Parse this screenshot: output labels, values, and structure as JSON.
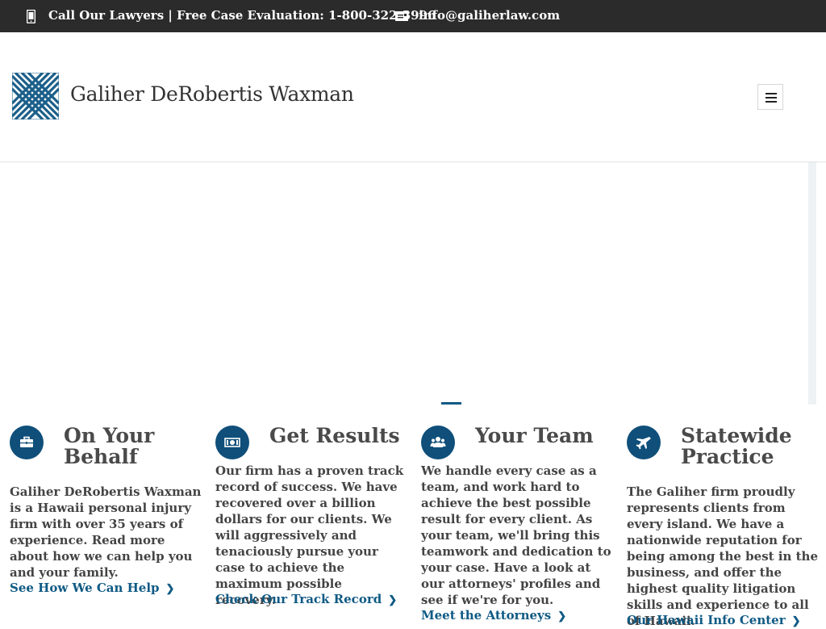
{
  "topbar": {
    "call_text": "Call Our Lawyers | Free Case Evaluation: 1-800-322-3996",
    "email": "info@galiherlaw.com",
    "phone_icon": "mobile-phone-icon",
    "mail_icon": "envelope-icon"
  },
  "header": {
    "brand_name": "Galiher DeRobertis Waxman",
    "logo_icon": "interlocking-x-logo",
    "menu_icon": "hamburger-menu-icon",
    "brand_color": "#1b5f8a"
  },
  "features": [
    {
      "icon": "briefcase-icon",
      "title": "On Your Behalf",
      "body": "Galiher DeRobertis Waxman is a Hawaii personal injury firm with over 35 years of experience. Read more about how we can help you and your family.",
      "link": "See How We Can Help"
    },
    {
      "icon": "money-icon",
      "title": "Get Results",
      "body": "Our firm has a proven track record of success. We have recovered over a billion dollars for our clients. We will aggressively and tenaciously pursue your case to achieve the maximum possible recovery.",
      "link": "Check Our Track Record"
    },
    {
      "icon": "team-icon",
      "title": "Your Team",
      "body": "We handle every case as a team, and work hard to achieve the best possible result for every client. As your team, we'll bring this teamwork and dedication to your case. Have a look at our attorneys' profiles and see if we're for you.",
      "link": "Meet the Attorneys"
    },
    {
      "icon": "airplane-icon",
      "title": "Statewide Practice",
      "body": "The Galiher firm proudly represents clients from every island. We have a nationwide reputation for being among the best in the business, and offer the highest quality litigation skills and experience to all of Hawaii.",
      "link": "Our Hawaii Info Center"
    }
  ]
}
